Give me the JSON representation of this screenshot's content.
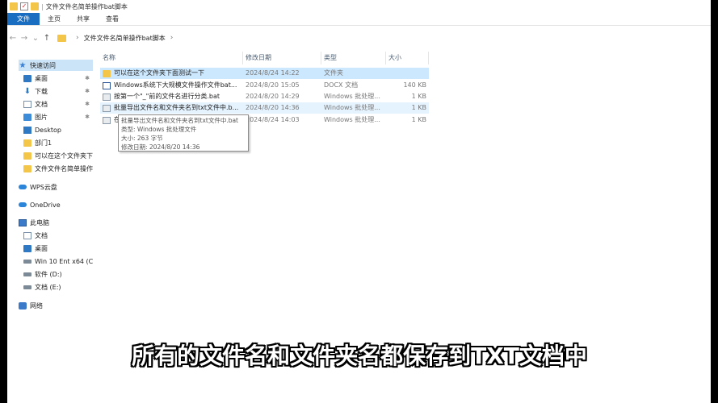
{
  "window": {
    "title": "文件文件名简单操作bat脚本"
  },
  "ribbon": {
    "tabs": [
      {
        "label": "文件"
      },
      {
        "label": "主页"
      },
      {
        "label": "共享"
      },
      {
        "label": "查看"
      }
    ]
  },
  "address": {
    "path": "文件文件名简单操作bat脚本"
  },
  "sidebar": {
    "items": [
      {
        "label": "快速访问",
        "icon": "star-icon"
      },
      {
        "label": "桌面",
        "icon": "desktop-icon"
      },
      {
        "label": "下载",
        "icon": "download-icon"
      },
      {
        "label": "文档",
        "icon": "document-icon"
      },
      {
        "label": "图片",
        "icon": "pictures-icon"
      },
      {
        "label": "Desktop",
        "icon": "folder-icon"
      },
      {
        "label": "部门1",
        "icon": "folder-icon"
      },
      {
        "label": "可以在这个文件夹下",
        "icon": "folder-icon"
      },
      {
        "label": "文件文件名简单操作",
        "icon": "folder-icon"
      },
      {
        "label": "WPS云盘",
        "icon": "cloud-icon"
      },
      {
        "label": "OneDrive",
        "icon": "cloud-icon"
      },
      {
        "label": "此电脑",
        "icon": "computer-icon"
      },
      {
        "label": "文档",
        "icon": "document-icon"
      },
      {
        "label": "桌面",
        "icon": "desktop-icon"
      },
      {
        "label": "Win 10 Ent x64 (C",
        "icon": "drive-icon"
      },
      {
        "label": "软件 (D:)",
        "icon": "drive-icon"
      },
      {
        "label": "文档 (E:)",
        "icon": "drive-icon"
      },
      {
        "label": "网络",
        "icon": "network-icon"
      }
    ]
  },
  "columns": {
    "name": "名称",
    "date": "修改日期",
    "type": "类型",
    "size": "大小"
  },
  "files": [
    {
      "name": "可以在这个文件夹下面测试一下",
      "date": "2024/8/24 14:22",
      "type": "文件夹",
      "size": "",
      "icon": "folder-icon"
    },
    {
      "name": "Windows系统下大规模文件操作文件bat...",
      "date": "2024/8/20 15:05",
      "type": "DOCX 文档",
      "size": "140 KB",
      "icon": "docx-icon"
    },
    {
      "name": "按第一个\"_\"前的文件名进行分类.bat",
      "date": "2024/8/20 14:29",
      "type": "Windows 批处理...",
      "size": "1 KB",
      "icon": "bat-icon"
    },
    {
      "name": "批量导出文件名和文件夹名到txt文件中.b...",
      "date": "2024/8/20 14:36",
      "type": "Windows 批处理...",
      "size": "1 KB",
      "icon": "bat-icon"
    },
    {
      "name": "在",
      "date": "2024/8/24 14:03",
      "type": "Windows 批处理...",
      "size": "1 KB",
      "icon": "bat-icon"
    }
  ],
  "tooltip": {
    "lines": [
      "批量导出文件名和文件夹名到txt文件中.bat",
      "类型: Windows 批处理文件",
      "大小: 263 字节",
      "修改日期: 2024/8/20 14:36"
    ]
  },
  "subtitle": "所有的文件名和文件夹名都保存到TXT文档中"
}
